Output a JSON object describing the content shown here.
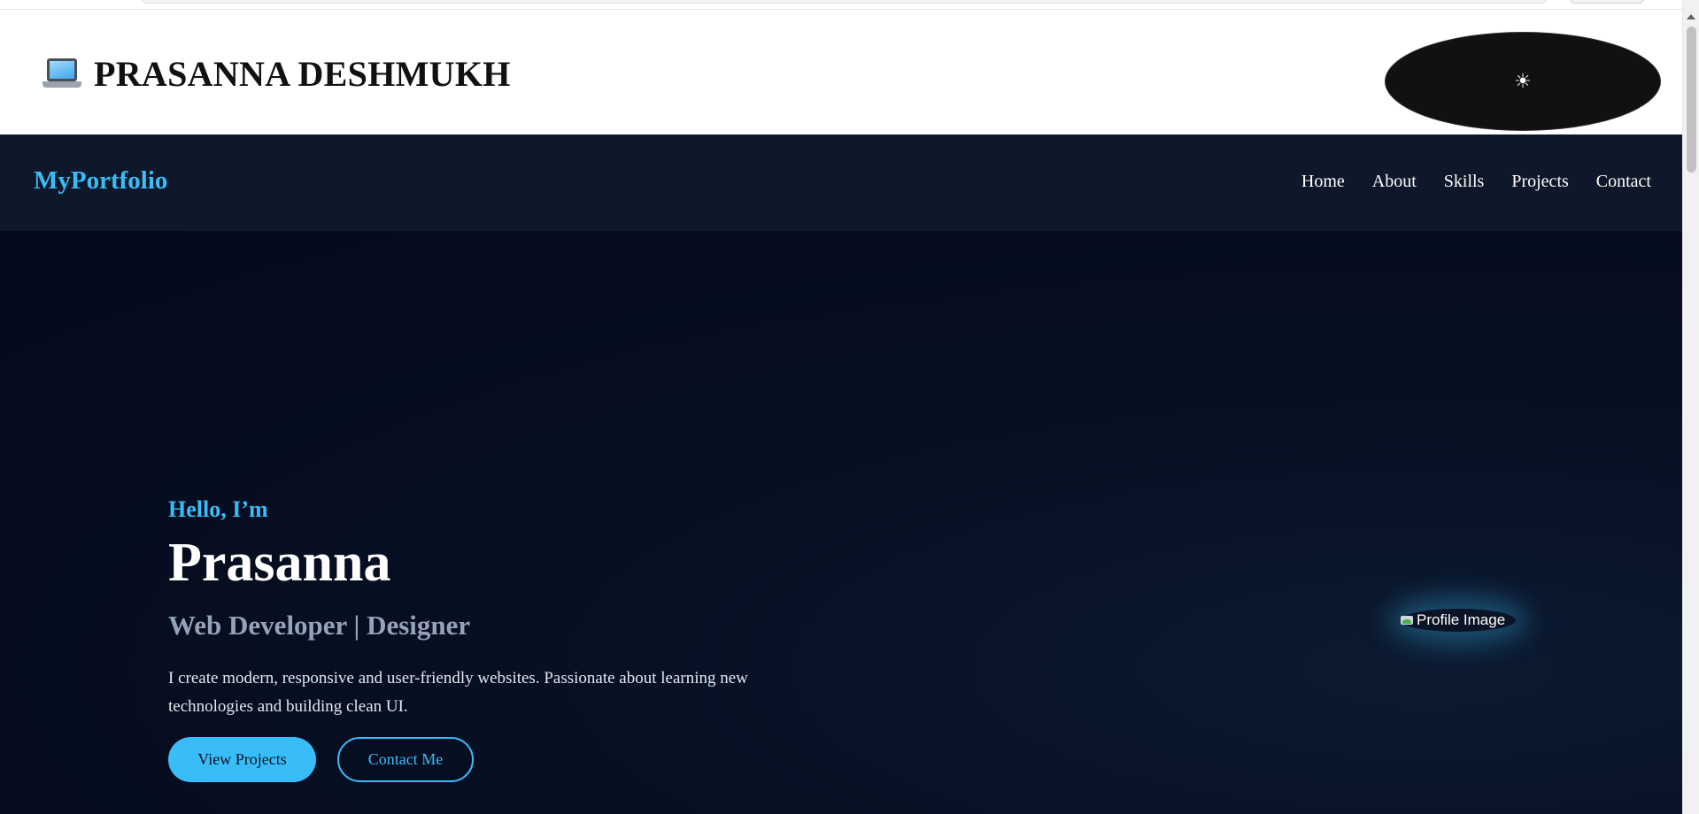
{
  "header": {
    "laptop_icon": "laptop-icon",
    "title": "PRASANNA DESHMUKH",
    "theme_toggle_icon": "☀"
  },
  "nav": {
    "logo": "MyPortfolio",
    "links": [
      "Home",
      "About",
      "Skills",
      "Projects",
      "Contact"
    ]
  },
  "hero": {
    "greeting": "Hello, I’m",
    "name": "Prasanna",
    "role": "Web Developer | Designer",
    "description": "I create modern, responsive and user-friendly websites. Passionate about learning new technologies and building clean UI.",
    "primary_button": "View Projects",
    "secondary_button": "Contact Me",
    "profile_image_alt": "Profile Image"
  },
  "colors": {
    "accent": "#38bdf8",
    "nav_bg": "#0f172a",
    "hero_bg": "#030a1c",
    "muted_text": "#94a3b8"
  }
}
